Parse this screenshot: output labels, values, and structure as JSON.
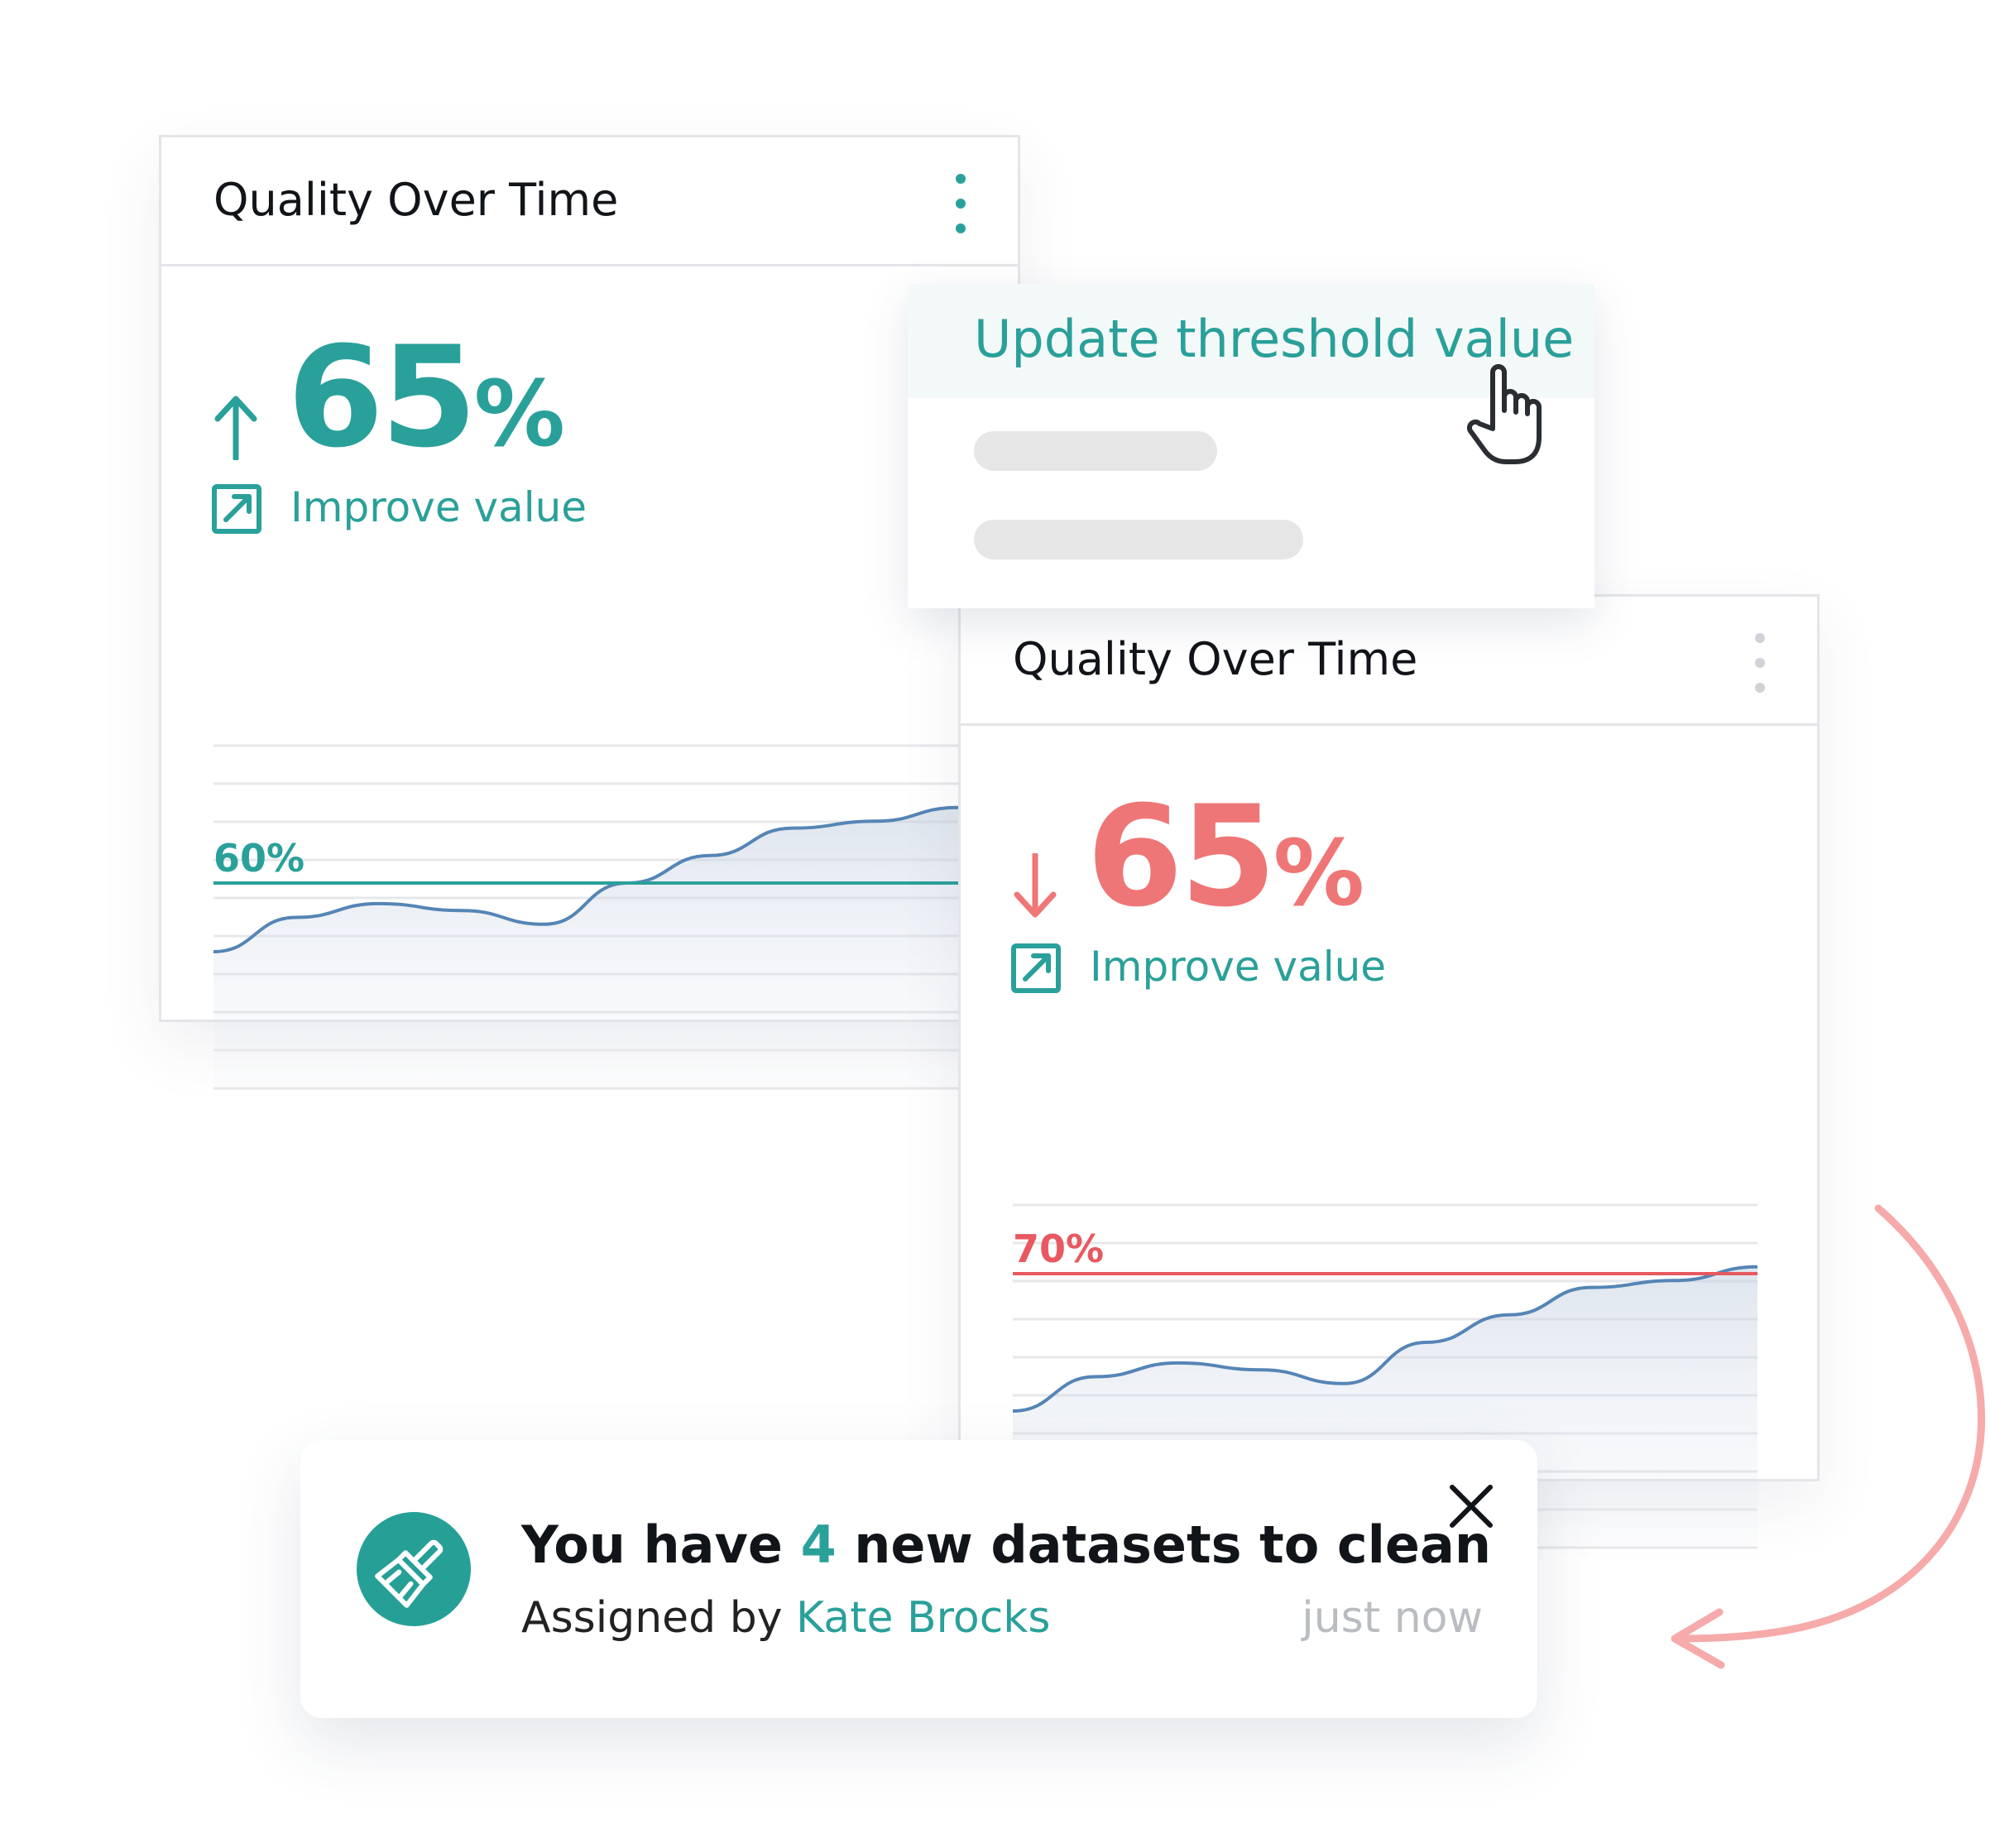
{
  "card_primary": {
    "title": "Quality Over Time",
    "trend": "up",
    "value": "65",
    "unit": "%",
    "action_label": "Improve value",
    "chart_data": {
      "type": "line",
      "threshold_label": "60%",
      "threshold_value": 60,
      "threshold_color": "#2aa09a",
      "values": [
        50,
        55,
        57,
        56,
        54,
        60,
        64,
        68,
        69,
        71
      ],
      "ylim": [
        30,
        80
      ],
      "grid": true
    }
  },
  "card_secondary": {
    "title": "Quality Over Time",
    "trend": "down",
    "value": "65",
    "unit": "%",
    "action_label": "Improve value",
    "chart_data": {
      "type": "line",
      "threshold_label": "70%",
      "threshold_value": 70,
      "threshold_color": "#e8595f",
      "values": [
        50,
        55,
        57,
        56,
        54,
        60,
        64,
        68,
        69,
        71
      ],
      "ylim": [
        30,
        80
      ],
      "grid": true
    }
  },
  "context_menu": {
    "item_label": "Update threshold value"
  },
  "toast": {
    "title_prefix": "You have ",
    "title_count": "4",
    "title_suffix": " new datasets to clean",
    "sub_prefix": "Assigned by ",
    "assignee": "Kate Brocks",
    "time": "just now",
    "icon": "broom-icon"
  },
  "colors": {
    "teal": "#2aa09a",
    "red": "#ef7676",
    "line": "#5585b5"
  }
}
